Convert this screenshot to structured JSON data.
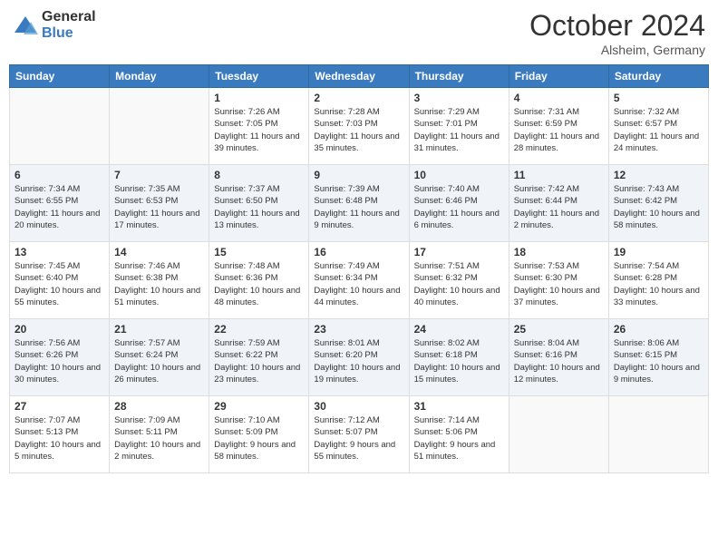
{
  "header": {
    "logo_general": "General",
    "logo_blue": "Blue",
    "month_title": "October 2024",
    "location": "Alsheim, Germany"
  },
  "weekdays": [
    "Sunday",
    "Monday",
    "Tuesday",
    "Wednesday",
    "Thursday",
    "Friday",
    "Saturday"
  ],
  "weeks": [
    [
      {
        "day": "",
        "info": ""
      },
      {
        "day": "",
        "info": ""
      },
      {
        "day": "1",
        "info": "Sunrise: 7:26 AM\nSunset: 7:05 PM\nDaylight: 11 hours and 39 minutes."
      },
      {
        "day": "2",
        "info": "Sunrise: 7:28 AM\nSunset: 7:03 PM\nDaylight: 11 hours and 35 minutes."
      },
      {
        "day": "3",
        "info": "Sunrise: 7:29 AM\nSunset: 7:01 PM\nDaylight: 11 hours and 31 minutes."
      },
      {
        "day": "4",
        "info": "Sunrise: 7:31 AM\nSunset: 6:59 PM\nDaylight: 11 hours and 28 minutes."
      },
      {
        "day": "5",
        "info": "Sunrise: 7:32 AM\nSunset: 6:57 PM\nDaylight: 11 hours and 24 minutes."
      }
    ],
    [
      {
        "day": "6",
        "info": "Sunrise: 7:34 AM\nSunset: 6:55 PM\nDaylight: 11 hours and 20 minutes."
      },
      {
        "day": "7",
        "info": "Sunrise: 7:35 AM\nSunset: 6:53 PM\nDaylight: 11 hours and 17 minutes."
      },
      {
        "day": "8",
        "info": "Sunrise: 7:37 AM\nSunset: 6:50 PM\nDaylight: 11 hours and 13 minutes."
      },
      {
        "day": "9",
        "info": "Sunrise: 7:39 AM\nSunset: 6:48 PM\nDaylight: 11 hours and 9 minutes."
      },
      {
        "day": "10",
        "info": "Sunrise: 7:40 AM\nSunset: 6:46 PM\nDaylight: 11 hours and 6 minutes."
      },
      {
        "day": "11",
        "info": "Sunrise: 7:42 AM\nSunset: 6:44 PM\nDaylight: 11 hours and 2 minutes."
      },
      {
        "day": "12",
        "info": "Sunrise: 7:43 AM\nSunset: 6:42 PM\nDaylight: 10 hours and 58 minutes."
      }
    ],
    [
      {
        "day": "13",
        "info": "Sunrise: 7:45 AM\nSunset: 6:40 PM\nDaylight: 10 hours and 55 minutes."
      },
      {
        "day": "14",
        "info": "Sunrise: 7:46 AM\nSunset: 6:38 PM\nDaylight: 10 hours and 51 minutes."
      },
      {
        "day": "15",
        "info": "Sunrise: 7:48 AM\nSunset: 6:36 PM\nDaylight: 10 hours and 48 minutes."
      },
      {
        "day": "16",
        "info": "Sunrise: 7:49 AM\nSunset: 6:34 PM\nDaylight: 10 hours and 44 minutes."
      },
      {
        "day": "17",
        "info": "Sunrise: 7:51 AM\nSunset: 6:32 PM\nDaylight: 10 hours and 40 minutes."
      },
      {
        "day": "18",
        "info": "Sunrise: 7:53 AM\nSunset: 6:30 PM\nDaylight: 10 hours and 37 minutes."
      },
      {
        "day": "19",
        "info": "Sunrise: 7:54 AM\nSunset: 6:28 PM\nDaylight: 10 hours and 33 minutes."
      }
    ],
    [
      {
        "day": "20",
        "info": "Sunrise: 7:56 AM\nSunset: 6:26 PM\nDaylight: 10 hours and 30 minutes."
      },
      {
        "day": "21",
        "info": "Sunrise: 7:57 AM\nSunset: 6:24 PM\nDaylight: 10 hours and 26 minutes."
      },
      {
        "day": "22",
        "info": "Sunrise: 7:59 AM\nSunset: 6:22 PM\nDaylight: 10 hours and 23 minutes."
      },
      {
        "day": "23",
        "info": "Sunrise: 8:01 AM\nSunset: 6:20 PM\nDaylight: 10 hours and 19 minutes."
      },
      {
        "day": "24",
        "info": "Sunrise: 8:02 AM\nSunset: 6:18 PM\nDaylight: 10 hours and 15 minutes."
      },
      {
        "day": "25",
        "info": "Sunrise: 8:04 AM\nSunset: 6:16 PM\nDaylight: 10 hours and 12 minutes."
      },
      {
        "day": "26",
        "info": "Sunrise: 8:06 AM\nSunset: 6:15 PM\nDaylight: 10 hours and 9 minutes."
      }
    ],
    [
      {
        "day": "27",
        "info": "Sunrise: 7:07 AM\nSunset: 5:13 PM\nDaylight: 10 hours and 5 minutes."
      },
      {
        "day": "28",
        "info": "Sunrise: 7:09 AM\nSunset: 5:11 PM\nDaylight: 10 hours and 2 minutes."
      },
      {
        "day": "29",
        "info": "Sunrise: 7:10 AM\nSunset: 5:09 PM\nDaylight: 9 hours and 58 minutes."
      },
      {
        "day": "30",
        "info": "Sunrise: 7:12 AM\nSunset: 5:07 PM\nDaylight: 9 hours and 55 minutes."
      },
      {
        "day": "31",
        "info": "Sunrise: 7:14 AM\nSunset: 5:06 PM\nDaylight: 9 hours and 51 minutes."
      },
      {
        "day": "",
        "info": ""
      },
      {
        "day": "",
        "info": ""
      }
    ]
  ]
}
